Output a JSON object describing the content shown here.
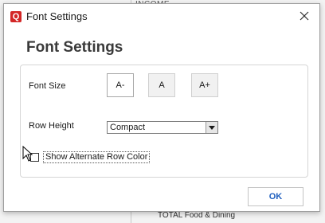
{
  "background": {
    "top_text": "INCOME",
    "bottom_text": "TOTAL Food & Dining"
  },
  "dialog": {
    "window_title": "Font Settings",
    "app_icon_letter": "Q",
    "heading": "Font Settings",
    "font_size": {
      "label": "Font Size",
      "buttons": [
        {
          "label": "A-",
          "selected": true
        },
        {
          "label": "A",
          "selected": false
        },
        {
          "label": "A+",
          "selected": false
        }
      ]
    },
    "row_height": {
      "label": "Row Height",
      "selected_value": "Compact"
    },
    "alternate_row_color": {
      "label": "Show Alternate Row Color",
      "checked": false
    },
    "ok_label": "OK"
  },
  "colors": {
    "app_icon": "#d32626",
    "ok_text": "#1f5fbf"
  },
  "icons": [
    "close-icon",
    "dropdown-arrow-icon",
    "app-logo-icon",
    "mouse-cursor-icon"
  ]
}
